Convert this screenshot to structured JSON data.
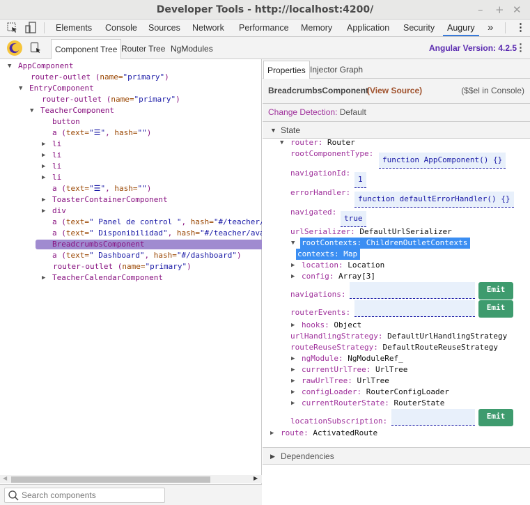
{
  "window": {
    "title": "Developer Tools - http://localhost:4200/",
    "min": "–",
    "max": "+",
    "close": "✕"
  },
  "tabs": [
    "Elements",
    "Console",
    "Sources",
    "Network",
    "Performance",
    "Memory",
    "Application",
    "Security",
    "Augury"
  ],
  "more_tabs": "»",
  "menu": "⋮",
  "augury": {
    "subtabs": [
      "Component Tree",
      "Router Tree",
      "NgModules"
    ],
    "angular_version": "Angular Version: 4.2.5"
  },
  "tree": [
    {
      "name": "AppComponent"
    },
    {
      "name": "router-outlet (",
      "attr": "name=",
      "val": "\"primary\"",
      "end": ")"
    },
    {
      "name": "EntryComponent"
    },
    {
      "name": "router-outlet (",
      "attr": "name=",
      "val": "\"primary\"",
      "end": ")"
    },
    {
      "name": "TeacherComponent"
    },
    {
      "name": "button"
    },
    {
      "name": "a (",
      "attr": "text=",
      "val": "\"☰\"",
      "end": ", ",
      "attr2": "hash=",
      "val2": "\"\"",
      "end2": ")"
    },
    {
      "name": "li"
    },
    {
      "name": "li"
    },
    {
      "name": "li"
    },
    {
      "name": "li"
    },
    {
      "name": "a (",
      "attr": "text=",
      "val": "\"☰\"",
      "end": ", ",
      "attr2": "hash=",
      "val2": "\"\"",
      "end2": ")"
    },
    {
      "name": "ToasterContainerComponent"
    },
    {
      "name": "div"
    },
    {
      "name": "a (",
      "attr": "text=",
      "val": "\" Panel de control \"",
      "end": ", ",
      "attr2": "hash=",
      "val2": "\"#/teacher/",
      "end2": ""
    },
    {
      "name": "a (",
      "attr": "text=",
      "val": "\" Disponibilidad\"",
      "end": ", ",
      "attr2": "hash=",
      "val2": "\"#/teacher/ava",
      "end2": ""
    },
    {
      "name": "BreadcrumbsComponent"
    },
    {
      "name": "a (",
      "attr": "text=",
      "val": "\"  Dashboard\"",
      "end": ", ",
      "attr2": "hash=",
      "val2": "\"#/dashboard\"",
      "end2": ")"
    },
    {
      "name": "router-outlet (",
      "attr": "name=",
      "val": "\"primary\"",
      "end": ")"
    },
    {
      "name": "TeacherCalendarComponent"
    }
  ],
  "search": {
    "placeholder": "Search components"
  },
  "right": {
    "tabs": [
      "Properties",
      "Injector Graph"
    ],
    "component": "BreadcrumbsComponent",
    "view_source": "(View Source)",
    "console_hint": "($$el in Console)",
    "cd_label": "Change Detection:",
    "cd_value": "Default",
    "state": "State",
    "dependencies": "Dependencies",
    "emit": "Emit"
  },
  "props": [
    {
      "k": "router:",
      "v": "Router"
    },
    {
      "k": "rootComponentType:",
      "v": "function AppComponent() {}"
    },
    {
      "k": "navigationId:",
      "v": "1"
    },
    {
      "k": "errorHandler:",
      "v": "function defaultErrorHandler() {}"
    },
    {
      "k": "navigated:",
      "v": "true"
    },
    {
      "k": "urlSerializer:",
      "v": "DefaultUrlSerializer"
    },
    {
      "k": "rootContexts:",
      "v": "ChildrenOutletContexts"
    },
    {
      "k": "contexts:",
      "v": "Map"
    },
    {
      "k": "location:",
      "v": "Location"
    },
    {
      "k": "config:",
      "v": "Array[3]"
    },
    {
      "k": "navigations:",
      "v": ""
    },
    {
      "k": "routerEvents:",
      "v": ""
    },
    {
      "k": "hooks:",
      "v": "Object"
    },
    {
      "k": "urlHandlingStrategy:",
      "v": "DefaultUrlHandlingStrategy"
    },
    {
      "k": "routeReuseStrategy:",
      "v": "DefaultRouteReuseStrategy"
    },
    {
      "k": "ngModule:",
      "v": "NgModuleRef_"
    },
    {
      "k": "currentUrlTree:",
      "v": "UrlTree"
    },
    {
      "k": "rawUrlTree:",
      "v": "UrlTree"
    },
    {
      "k": "configLoader:",
      "v": "RouterConfigLoader"
    },
    {
      "k": "currentRouterState:",
      "v": "RouterState"
    },
    {
      "k": "locationSubscription:",
      "v": ""
    },
    {
      "k": "route:",
      "v": "ActivatedRoute"
    }
  ]
}
